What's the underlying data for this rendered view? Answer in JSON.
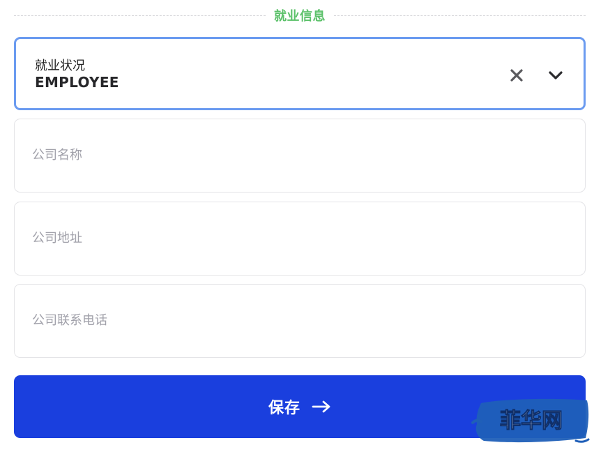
{
  "section": {
    "title": "就业信息"
  },
  "employment_status": {
    "label": "就业状况",
    "value": "EMPLOYEE"
  },
  "fields": {
    "company_name": {
      "placeholder": "公司名称",
      "value": ""
    },
    "company_address": {
      "placeholder": "公司地址",
      "value": ""
    },
    "company_phone": {
      "placeholder": "公司联系电话",
      "value": ""
    }
  },
  "save_button": {
    "label": "保存"
  },
  "watermark": {
    "text": "菲华网"
  },
  "colors": {
    "section_title": "#5cc16a",
    "focus_border": "#6b9bf0",
    "primary_button": "#1a3fde",
    "watermark_brush": "#1f5fb8"
  },
  "icons": {
    "clear": "close-icon",
    "dropdown": "chevron-down-icon",
    "submit_arrow": "arrow-right-icon"
  }
}
